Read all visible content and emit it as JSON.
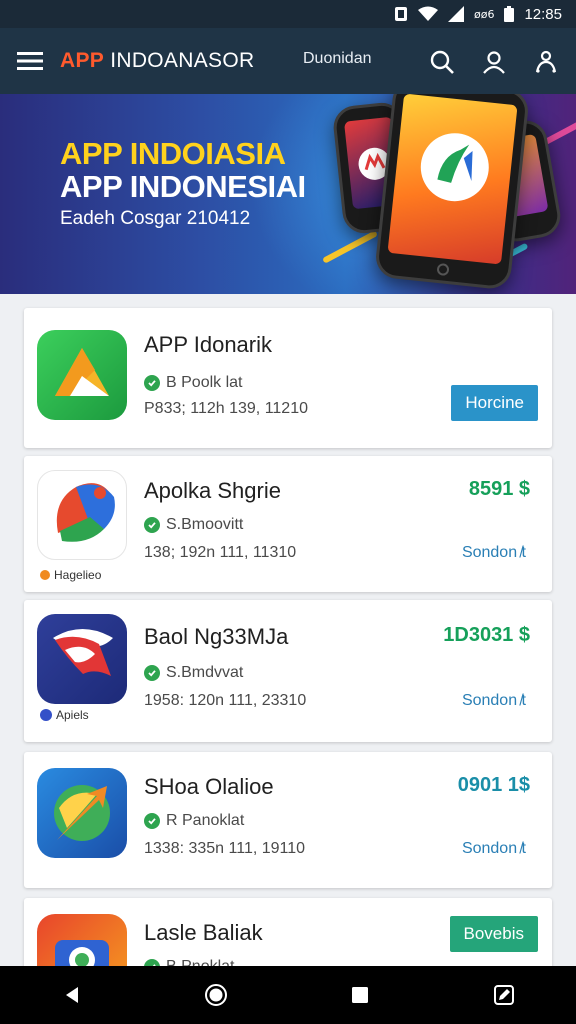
{
  "status_bar": {
    "icons": [
      "notification-icon",
      "wifi-icon",
      "signal-icon",
      "battery-icon"
    ],
    "network_label": "øø6",
    "time": "12:85"
  },
  "app_bar": {
    "brand_accent": "APP",
    "brand_rest": " INDOANASOR",
    "link": "Duonidan",
    "icons": [
      "menu-icon",
      "search-icon",
      "account-icon",
      "share-icon"
    ],
    "colors": {
      "background": "#1f3446",
      "accent": "#ff5a2d"
    }
  },
  "banner": {
    "title_line1": "APP INDOIASIA",
    "title_line2": "APP INDONESIAI",
    "subtitle": "Eadeh Cosgar 210412"
  },
  "apps": [
    {
      "title": "APP Idonarik",
      "meta": "B Poolk lat",
      "info": "P833; 112h 139, 11210",
      "action": "Horcine",
      "icon": "drive-triangle-icon"
    },
    {
      "title": "Apolka Shgrie",
      "meta": "S.Bmoovitt",
      "info": "138; 192n 111, 11310",
      "price": "8591 $",
      "link": "Sondon ̸t",
      "badge": "Hagelieo",
      "icon": "maps-pin-icon"
    },
    {
      "title": "Baol Ng33MJa",
      "meta": "S.Bmdvvat",
      "info": "1958: 120n 111, 23310",
      "price": "1D3031 $",
      "link": "Sondon ̸t",
      "badge": "Apiels",
      "icon": "red-swirl-icon"
    },
    {
      "title": "SHoa Olalioe",
      "meta": "R Panoklat",
      "info": "1338: 335n 111, 19110",
      "price": "0901 1$",
      "link": "Sondon ̸t",
      "icon": "arrow-globe-icon"
    },
    {
      "title": "Lasle Baliak",
      "meta": "B Pnoklat",
      "action": "Bovebis",
      "icon": "colorful-camera-icon"
    }
  ],
  "nav_bar": {
    "icons": [
      "back-icon",
      "home-icon",
      "recents-icon",
      "edit-icon"
    ]
  }
}
